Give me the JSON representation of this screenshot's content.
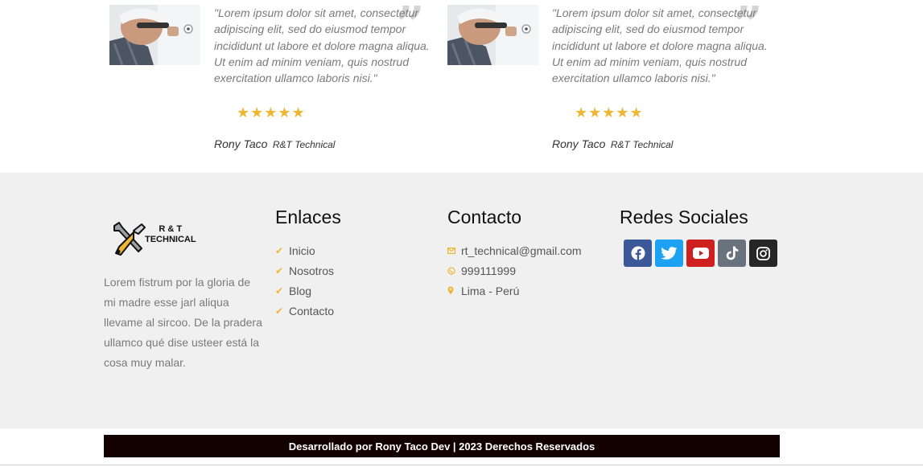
{
  "testimonials": [
    {
      "quote": "\"Lorem ipsum dolor sit amet, consectetur adipiscing elit, sed do eiusmod tempor incididunt ut labore et dolore magna aliqua. Ut enim ad minim veniam, quis nostrud exercitation ullamco laboris nisi.\"",
      "stars": "★★★★★",
      "rating": 5,
      "name": "Rony Taco",
      "company": "R&T Technical"
    },
    {
      "quote": "\"Lorem ipsum dolor sit amet, consectetur adipiscing elit, sed do eiusmod tempor incididunt ut labore et dolore magna aliqua. Ut enim ad minim veniam, quis nostrud exercitation ullamco laboris nisi.\"",
      "stars": "★★★★★",
      "rating": 5,
      "name": "Rony Taco",
      "company": "R&T Technical"
    }
  ],
  "footer": {
    "logo_line1": "R & T",
    "logo_line2": "TECHNICAL",
    "about": "Lorem fistrum por la gloria de mi madre esse jarl aliqua llevame al sircoo. De la pradera ullamco qué dise usteer está la cosa muy malar.",
    "links_title": "Enlaces",
    "links": [
      "Inicio",
      "Nosotros",
      "Blog",
      "Contacto"
    ],
    "contact_title": "Contacto",
    "email": "rt_technical@gmail.com",
    "phone": "999111999",
    "location": "Lima - Perú",
    "social_title": "Redes Sociales",
    "social": [
      {
        "icon": "facebook-icon",
        "color": "#3b5998"
      },
      {
        "icon": "twitter-icon",
        "color": "#1da1f2"
      },
      {
        "icon": "youtube-icon",
        "color": "#cd201f"
      },
      {
        "icon": "tiktok-icon",
        "color": "#69727d"
      },
      {
        "icon": "instagram-icon",
        "color": "#262626"
      }
    ]
  },
  "bottom_bar": {
    "credit": "Desarrollado por Rony Taco Dev | 2023 Derechos Reservados"
  },
  "colors": {
    "accent": "#efb634",
    "footer_bg": "#f0f0f0",
    "credit_bg": "#130000"
  }
}
